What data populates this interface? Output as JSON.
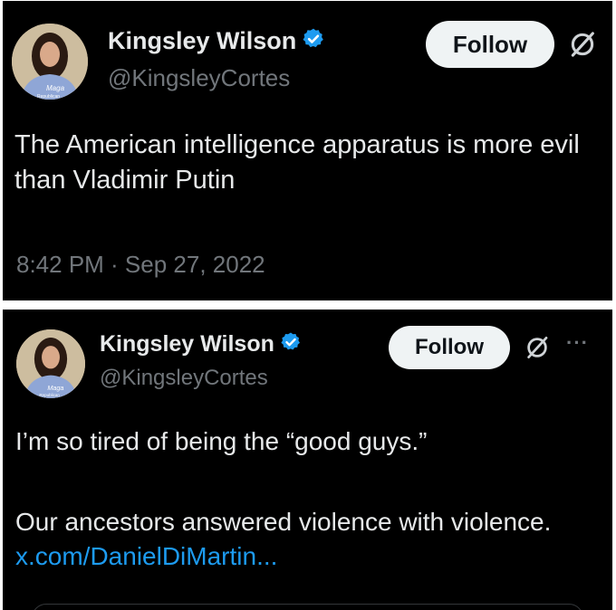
{
  "tweet1": {
    "display_name": "Kingsley Wilson",
    "handle": "@KingsleyCortes",
    "follow_label": "Follow",
    "text": "The American intelligence apparatus is more evil than Vladimir Putin",
    "timestamp": "8:42 PM · Sep 27, 2022",
    "avatar_shirt_text": "Maga Republican"
  },
  "tweet2": {
    "display_name": "Kingsley Wilson",
    "handle": "@KingsleyCortes",
    "follow_label": "Follow",
    "more_label": "···",
    "text_line1": "I’m so tired of being the “good guys.”",
    "text_line2": "Our ancestors answered violence with violence.",
    "link_text": "x.com/DanielDiMartin...",
    "avatar_shirt_text": "Maga Republican"
  },
  "colors": {
    "background": "#000000",
    "name": "#e7e9ea",
    "secondary": "#71767b",
    "link": "#1d9bf0",
    "verified": "#1d9bf0",
    "button_bg": "#eff3f4"
  },
  "icons": [
    "verified-badge-icon",
    "grok-icon",
    "more-options-icon",
    "avatar"
  ]
}
